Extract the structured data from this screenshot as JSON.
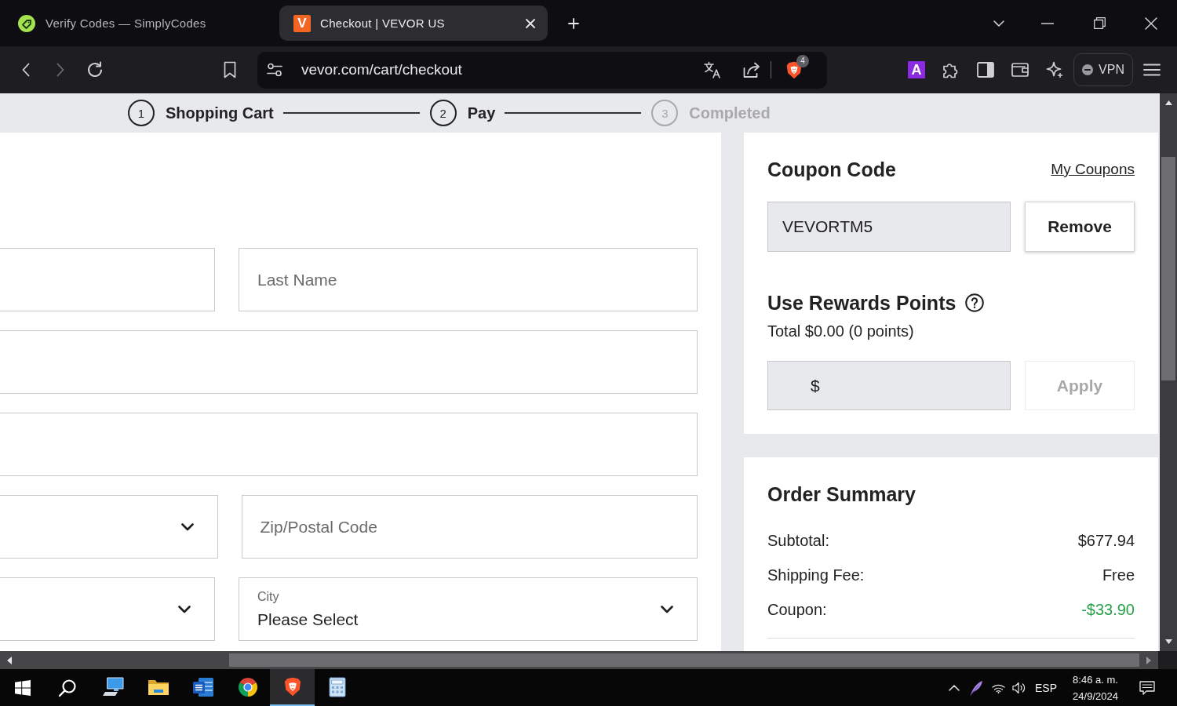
{
  "browser": {
    "tabs": [
      {
        "title": "Verify Codes — SimplyCodes",
        "selected": false
      },
      {
        "title": "Checkout | VEVOR US",
        "favicon_letter": "V",
        "selected": true
      }
    ],
    "navigation": {
      "back_enabled": true,
      "forward_enabled": false
    },
    "address": "vevor.com/cart/checkout",
    "shields_badge": "4",
    "extension_letter": "A",
    "vpn": {
      "label": "VPN",
      "connected": false
    }
  },
  "checkout_steps": [
    {
      "number": "1",
      "label": "Shopping Cart",
      "reached": true
    },
    {
      "number": "2",
      "label": "Pay",
      "reached": true
    },
    {
      "number": "3",
      "label": "Completed",
      "reached": false
    }
  ],
  "address_form": {
    "rows": [
      [
        {
          "kind": "text"
        },
        {
          "kind": "text",
          "placeholder": "Last Name"
        }
      ],
      [
        {
          "kind": "text"
        }
      ],
      [
        {
          "kind": "text"
        }
      ],
      [
        {
          "kind": "select"
        },
        {
          "kind": "text",
          "placeholder": "Zip/Postal Code"
        }
      ],
      [
        {
          "kind": "select"
        },
        {
          "kind": "select",
          "label": "City",
          "value": "Please Select"
        }
      ]
    ]
  },
  "coupon": {
    "title": "Coupon Code",
    "link": "My Coupons",
    "code": "VEVORTM5",
    "button": "Remove"
  },
  "rewards": {
    "title": "Use Rewards Points",
    "total": "Total $0.00 (0 points)",
    "prefix": "$",
    "button": {
      "label": "Apply",
      "disabled": true
    }
  },
  "order_summary": {
    "title": "Order Summary",
    "rows": [
      {
        "label": "Subtotal:",
        "value": "$677.94",
        "kind": "amount"
      },
      {
        "label": "Shipping Fee:",
        "value": "Free",
        "kind": "amount"
      },
      {
        "label": "Coupon:",
        "value": "-$33.90",
        "kind": "discount"
      }
    ]
  },
  "taskbar": {
    "apps": [
      {
        "kind": "computer",
        "selected": false
      },
      {
        "kind": "folder",
        "selected": false
      },
      {
        "kind": "document",
        "selected": false
      },
      {
        "kind": "round-browser",
        "selected": false
      },
      {
        "kind": "lion-browser",
        "selected": true
      },
      {
        "kind": "calculator",
        "selected": false
      }
    ],
    "language": "ESP",
    "time": "8:46 a. m.",
    "date": "24/9/2024"
  }
}
